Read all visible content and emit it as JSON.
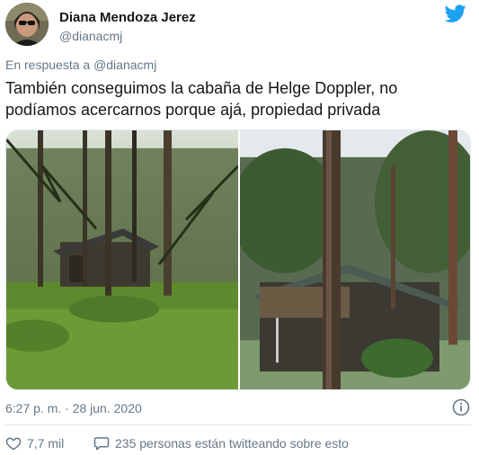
{
  "author": {
    "name": "Diana Mendoza Jerez",
    "handle": "@dianacmj"
  },
  "reply_to": {
    "prefix": "En respuesta a",
    "mention": "@dianacmj"
  },
  "tweet": {
    "text": "También conseguimos la cabaña de Helge Doppler, no podíamos acercarnos porque ajá, propiedad privada"
  },
  "media": {
    "photos": [
      "forest-cabin-photo-left",
      "forest-cabin-photo-right"
    ]
  },
  "meta": {
    "timestamp": "6:27 p. m. · 28 jun. 2020"
  },
  "actions": {
    "likes": "7,7 mil",
    "conversation": "235 personas están twitteando sobre esto"
  },
  "icons": {
    "brand": "twitter-bird-icon",
    "info": "info-icon",
    "like": "heart-icon",
    "reply": "speech-bubble-icon"
  },
  "colors": {
    "twitter_blue": "#1da1f2",
    "secondary_text": "#657786",
    "primary_text": "#14171a",
    "border": "#e1e8ed"
  }
}
